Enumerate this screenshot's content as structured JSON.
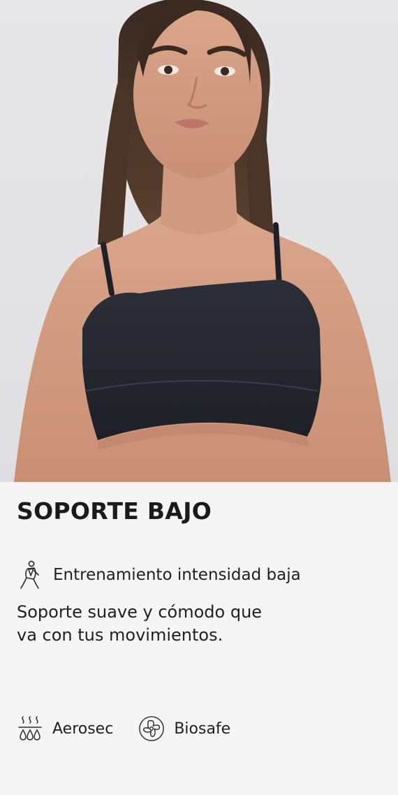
{
  "product": {
    "title": "SOPORTE BAJO",
    "activity": {
      "icon": "person-exercise-icon",
      "label": "Entrenamiento intensidad baja"
    },
    "description": {
      "line1": "Soporte suave y cómodo que",
      "line2": "va con tus movimientos."
    },
    "features": [
      {
        "icon": "heat-drops-icon",
        "label": "Aerosec"
      },
      {
        "icon": "biosafe-icon",
        "label": "Biosafe"
      }
    ]
  },
  "colors": {
    "background": "#f5f5f5",
    "text": "#1b1b1b",
    "garment": "#24262f"
  }
}
